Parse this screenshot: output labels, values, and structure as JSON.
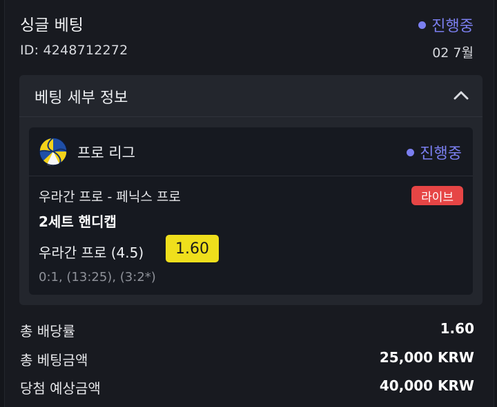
{
  "header": {
    "title": "싱글 베팅",
    "status": "진행중",
    "bet_id": "ID: 4248712272",
    "date": "02 7월"
  },
  "details": {
    "section_title": "베팅 세부 정보",
    "league": {
      "icon": "volleyball-icon",
      "name": "프로 리그",
      "status": "진행중"
    },
    "match": "우라간 프로 - 페닉스 프로",
    "badge": "라이브",
    "market": "2세트 핸디캡",
    "selection": "우라간 프로 (4.5)",
    "odds": "1.60",
    "score": "0:1, (13:25), (3:2*)"
  },
  "summary": [
    {
      "label": "총 배당률",
      "value": "1.60"
    },
    {
      "label": "총 베팅금액",
      "value": "25,000 KRW"
    },
    {
      "label": "당첨 예상금액",
      "value": "40,000 KRW"
    }
  ],
  "colors": {
    "background": "#181a20",
    "panel": "#23262d",
    "card": "#161920",
    "status": "#7b7ff0",
    "live_badge": "#e64545",
    "odds_chip": "#efdf1c"
  }
}
